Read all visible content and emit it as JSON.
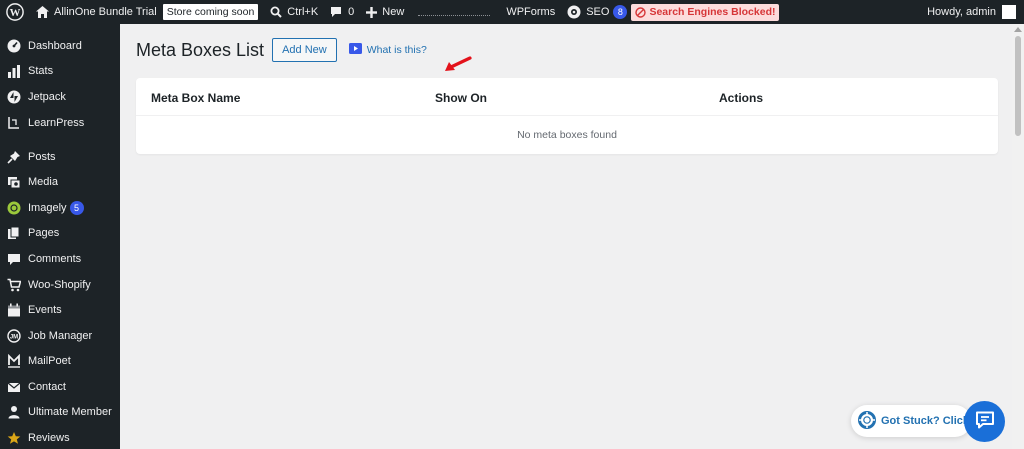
{
  "admin_bar": {
    "site_name": "AllinOne Bundle Trial",
    "store_badge": "Store coming soon",
    "search_shortcut": "Ctrl+K",
    "comments_count": "0",
    "new_label": "New",
    "wpforms_label": "WPForms",
    "seo_label": "SEO",
    "seo_count": "8",
    "blocked_label": "Search Engines Blocked!",
    "greeting": "Howdy, admin"
  },
  "sidebar": {
    "items": [
      {
        "label": "Dashboard",
        "icon": "dashboard-icon"
      },
      {
        "label": "Stats",
        "icon": "stats-icon"
      },
      {
        "label": "Jetpack",
        "icon": "jetpack-icon"
      },
      {
        "label": "LearnPress",
        "icon": "learnpress-icon"
      },
      {
        "label": "Posts",
        "icon": "pin-icon"
      },
      {
        "label": "Media",
        "icon": "media-icon"
      },
      {
        "label": "Imagely",
        "icon": "imagely-icon",
        "badge": "5"
      },
      {
        "label": "Pages",
        "icon": "pages-icon"
      },
      {
        "label": "Comments",
        "icon": "comments-icon"
      },
      {
        "label": "Woo-Shopify",
        "icon": "cart-icon"
      },
      {
        "label": "Events",
        "icon": "calendar-icon"
      },
      {
        "label": "Job Manager",
        "icon": "job-manager-icon"
      },
      {
        "label": "MailPoet",
        "icon": "mailpoet-icon"
      },
      {
        "label": "Contact",
        "icon": "mail-icon"
      },
      {
        "label": "Ultimate Member",
        "icon": "user-icon"
      },
      {
        "label": "Reviews",
        "icon": "star-icon"
      }
    ]
  },
  "main": {
    "title": "Meta Boxes List",
    "add_new_label": "Add New",
    "help_link": "What is this?",
    "table": {
      "columns": [
        "Meta Box Name",
        "Show On",
        "Actions"
      ],
      "empty_message": "No meta boxes found"
    }
  },
  "help_widget": {
    "label": "Got Stuck? Click"
  },
  "colors": {
    "admin_bg": "#1d2327",
    "accent": "#2271b1",
    "badge": "#3858e9",
    "blocked_bg": "#fcdcdc",
    "blocked_text": "#d63638",
    "chat": "#1a6fd8"
  }
}
